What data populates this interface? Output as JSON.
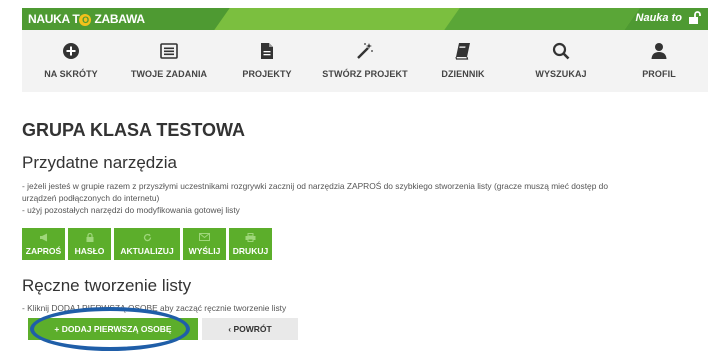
{
  "header": {
    "brand_left": "NAUKA T",
    "brand_o": "O",
    "brand_right": " ZABAWA",
    "user": "Nauka to"
  },
  "nav": [
    {
      "label": "NA SKRÓTY",
      "icon": "plus-circle-icon"
    },
    {
      "label": "TWOJE ZADANIA",
      "icon": "list-icon"
    },
    {
      "label": "PROJEKTY",
      "icon": "document-icon"
    },
    {
      "label": "STWÓRZ PROJEKT",
      "icon": "magic-wand-icon"
    },
    {
      "label": "DZIENNIK",
      "icon": "book-icon"
    },
    {
      "label": "WYSZUKAJ",
      "icon": "search-icon"
    },
    {
      "label": "PROFIL",
      "icon": "user-icon"
    }
  ],
  "main": {
    "title": "GRUPA KLASA TESTOWA",
    "tools_section": {
      "title": "Przydatne narzędzia",
      "line1": "- jeżeli jesteś w grupie razem z przyszłymi uczestnikami rozgrywki zacznij od narzędzia ZAPROŚ do szybkiego stworzenia listy (gracze muszą mieć dostęp do",
      "line2": "urządzeń podłączonych do internetu)",
      "line3": "- użyj pozostałych narzędzi do modyfikowania gotowej listy"
    },
    "tools": [
      {
        "label": "ZAPROŚ",
        "icon": "megaphone-icon"
      },
      {
        "label": "HASŁO",
        "icon": "lock-icon"
      },
      {
        "label": "AKTUALIZUJ",
        "icon": "refresh-icon"
      },
      {
        "label": "WYŚLIJ",
        "icon": "envelope-icon"
      },
      {
        "label": "DRUKUJ",
        "icon": "printer-icon"
      }
    ],
    "manual_section": {
      "title": "Ręczne tworzenie listy",
      "line1": "- Kliknij DODAJ PIERWSZĄ OSOBĘ aby zacząć ręcznie tworzenie listy"
    },
    "add_button": "+ DODAJ PIERWSZĄ OSOBĘ",
    "back_button": "‹ POWRÓT"
  },
  "colors": {
    "green_dark": "#4e9a32",
    "green_button": "#5cae2b",
    "highlight_ellipse": "#1f5ea8"
  }
}
